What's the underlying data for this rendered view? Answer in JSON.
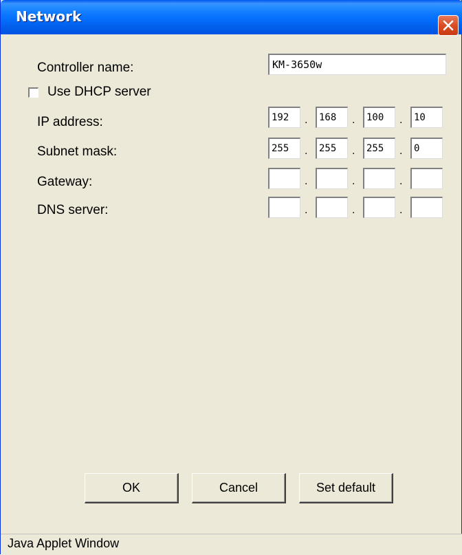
{
  "window": {
    "title": "Network",
    "close_icon": "close-icon",
    "close_color": "#d8461c"
  },
  "form": {
    "controller_name_label": "Controller name:",
    "controller_name_value": "KM-3650w",
    "dhcp_label": "Use DHCP server",
    "dhcp_checked": false,
    "ip_label": "IP address:",
    "ip_octets": [
      "192",
      "168",
      "100",
      "10"
    ],
    "subnet_label": "Subnet mask:",
    "subnet_octets": [
      "255",
      "255",
      "255",
      "0"
    ],
    "gateway_label": "Gateway:",
    "gateway_octets": [
      "",
      "",
      "",
      ""
    ],
    "dns_label": "DNS server:",
    "dns_octets": [
      "",
      "",
      "",
      ""
    ],
    "separator": "."
  },
  "buttons": {
    "ok": "OK",
    "cancel": "Cancel",
    "set_default": "Set default"
  },
  "status": {
    "text": "Java Applet Window"
  }
}
